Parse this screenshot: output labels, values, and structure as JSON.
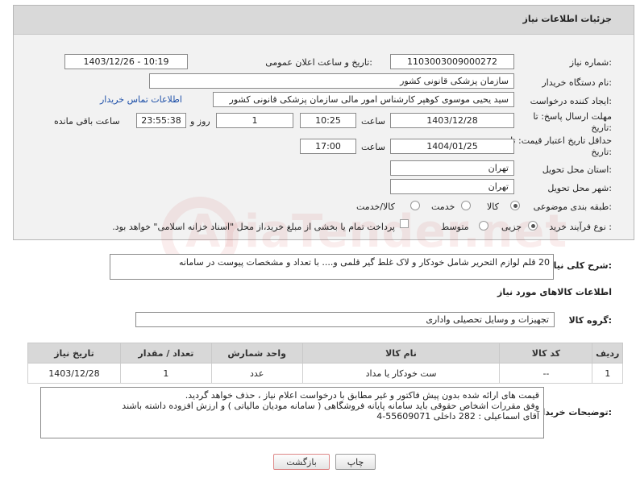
{
  "header": {
    "title": "جزئیات اطلاعات نیاز"
  },
  "fields": {
    "need_number": {
      "label": "شماره نیاز:",
      "value": "1103003009000272"
    },
    "announce_datetime": {
      "label": "تاریخ و ساعت اعلان عمومی:",
      "value": "1403/12/26 - 10:19"
    },
    "buyer_org": {
      "label": "نام دستگاه خریدار:",
      "value": "سازمان پزشکی قانونی کشور"
    },
    "requester": {
      "label": "ایجاد کننده درخواست:",
      "value": "سید یحیی موسوی کوهپر کارشناس امور مالی سازمان پزشکی قانونی کشور",
      "contact_link": "اطلاعات تماس خریدار"
    },
    "reply_deadline": {
      "label_line1": "مهلت ارسال پاسخ: تا",
      "label_line2": "تاریخ:",
      "date": "1403/12/28",
      "time_label": "ساعت",
      "time": "10:25",
      "days": "1",
      "days_label": "روز و",
      "remaining": "23:55:38",
      "remaining_label": "ساعت باقی مانده"
    },
    "price_validity": {
      "label_line1": "حداقل تاریخ اعتبار قیمت: تا",
      "label_line2": "تاریخ:",
      "date": "1404/01/25",
      "time_label": "ساعت",
      "time": "17:00"
    },
    "province": {
      "label": "استان محل تحویل:",
      "value": "تهران"
    },
    "city": {
      "label": "شهر محل تحویل:",
      "value": "تهران"
    },
    "category": {
      "label": "طبقه بندی موضوعی:",
      "options": [
        "کالا",
        "خدمت",
        "کالا/خدمت"
      ],
      "selected": "کالا"
    },
    "purchase_type": {
      "label": "نوع فرآیند خرید :",
      "options": [
        "جزیی",
        "متوسط"
      ],
      "selected": "جزیی",
      "payment_note": "پرداخت تمام یا بخشی از مبلغ خرید،از محل \"اسناد خزانه اسلامی\" خواهد بود."
    }
  },
  "description": {
    "label": "شرح کلی نیاز:",
    "value": "20 قلم لوازم التحریر شامل خودکار و لاک غلط گیر قلمی  و.... با تعداد و مشخصات پیوست در سامانه"
  },
  "goods_info": {
    "title": "اطلاعات کالاهای مورد نیاز",
    "group_label": "گروه کالا:",
    "group_value": "تجهیزات و وسایل تحصیلی واداری",
    "columns": [
      "ردیف",
      "کد کالا",
      "نام کالا",
      "واحد شمارش",
      "تعداد / مقدار",
      "تاریخ نیاز"
    ],
    "rows": [
      {
        "row": "1",
        "code": "--",
        "name": "ست خودکار یا مداد",
        "unit": "عدد",
        "qty": "1",
        "date": "1403/12/28"
      }
    ]
  },
  "buyer_notes": {
    "label": "توضیحات خریدار:",
    "lines": [
      "قیمت های ارائه شده بدون پیش فاکتور  و غیر مطابق با درخواست اعلام نیاز  ، حذف خواهد گردید.",
      "وفق مقررات اشخاص حقوقی باید سامانه پایانه فروشگاهی ( سامانه مودیان مالیاتی ) و ارزش افزوده  داشته باشند",
      "آقای اسماعیلی :   282   داخلی       55609071-4"
    ]
  },
  "buttons": {
    "print": "چاپ",
    "back": "بازگشت"
  },
  "watermark": "AriaTender.net"
}
